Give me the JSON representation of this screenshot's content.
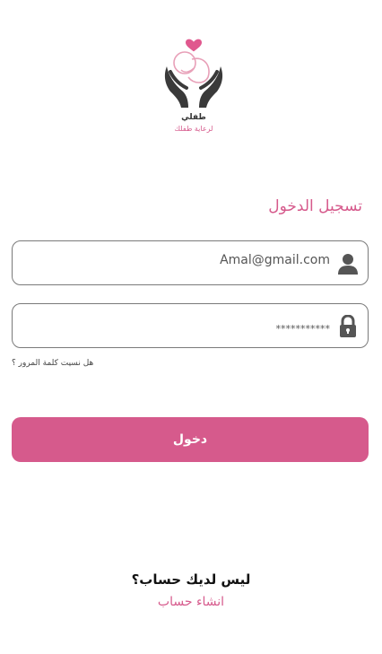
{
  "logo": {
    "name": "طفلي",
    "tagline": "لرعاية طفلك"
  },
  "login": {
    "title": "تسجيل الدخول",
    "email_value": "Amal@gmail.com",
    "password_value": "***********",
    "forgot_password": "هل نسيت كلمة المرور ؟",
    "submit_label": "دخول"
  },
  "signup": {
    "prompt": "ليس لديك  حساب؟",
    "link_label": "انشاء حساب"
  },
  "colors": {
    "accent": "#d65a8c",
    "icon": "#555555",
    "border": "#7a7a7a"
  },
  "icons": {
    "email_field": "user-icon",
    "password_field": "lock-icon"
  }
}
